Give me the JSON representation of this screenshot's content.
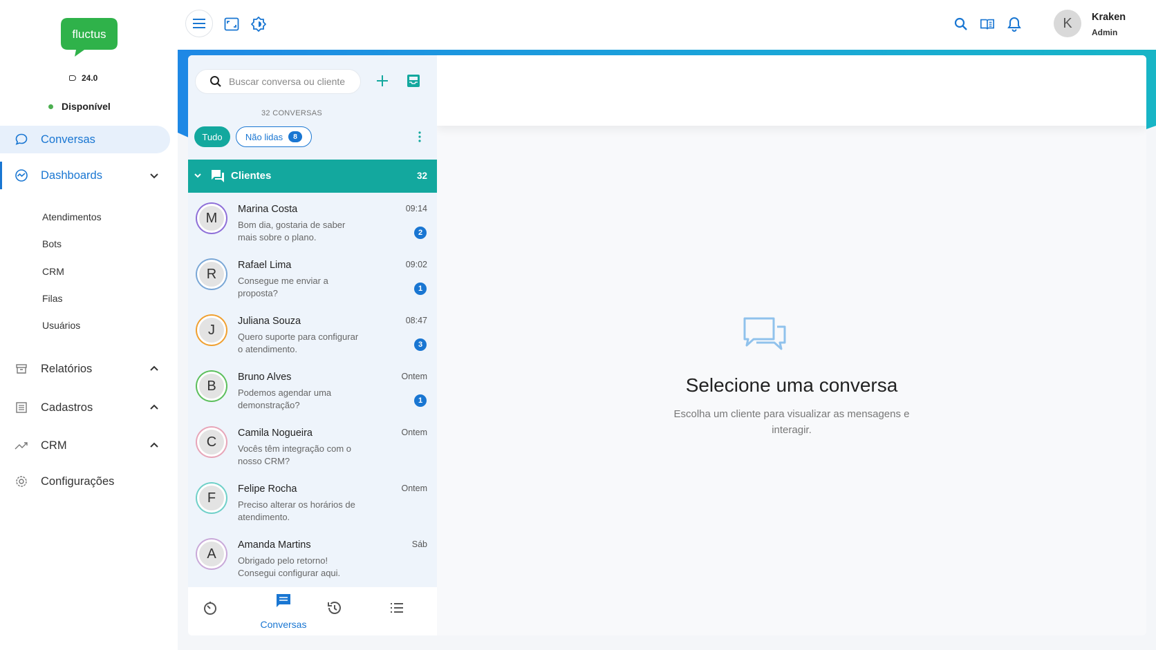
{
  "app": {
    "logo_text": "fluctus",
    "version": "24.0",
    "status": "Disponível"
  },
  "sidebar": {
    "items": [
      {
        "label": "Conversas",
        "icon": "chat-bubble-icon",
        "active": true
      },
      {
        "label": "Dashboards",
        "icon": "dashboard-icon",
        "expanded": true
      },
      {
        "label": "Relatórios",
        "icon": "archive-icon"
      },
      {
        "label": "Cadastros",
        "icon": "list-icon"
      },
      {
        "label": "CRM",
        "icon": "trending-icon"
      },
      {
        "label": "Configurações",
        "icon": "gear-icon"
      }
    ],
    "dashboards_sub": [
      "Atendimentos",
      "Bots",
      "CRM",
      "Filas",
      "Usuários"
    ]
  },
  "topbar": {
    "user_initial": "K",
    "user_name": "Kraken",
    "user_role": "Admin"
  },
  "conversations": {
    "search_placeholder": "Buscar conversa ou cliente",
    "count_label": "32 CONVERSAS",
    "filter_all": "Tudo",
    "filter_unread": "Não lidas",
    "unread_count": "8",
    "group_name": "Clientes",
    "group_count": "32",
    "items": [
      {
        "initial": "M",
        "name": "Marina Costa",
        "time": "09:14",
        "message": "Bom dia, gostaria de saber mais sobre o plano.",
        "unread": "2",
        "ring": "#8e6fd8"
      },
      {
        "initial": "R",
        "name": "Rafael Lima",
        "time": "09:02",
        "message": "Consegue me enviar a proposta?",
        "unread": "1",
        "ring": "#7aa7d6"
      },
      {
        "initial": "J",
        "name": "Juliana Souza",
        "time": "08:47",
        "message": "Quero suporte para configurar o atendimento.",
        "unread": "3",
        "ring": "#f0a030"
      },
      {
        "initial": "B",
        "name": "Bruno Alves",
        "time": "Ontem",
        "message": "Podemos agendar uma demonstração?",
        "unread": "1",
        "ring": "#5cbf5c"
      },
      {
        "initial": "C",
        "name": "Camila Nogueira",
        "time": "Ontem",
        "message": "Vocês têm integração com o nosso CRM?",
        "unread": "",
        "ring": "#e7a5b8"
      },
      {
        "initial": "F",
        "name": "Felipe Rocha",
        "time": "Ontem",
        "message": "Preciso alterar os horários de atendimento.",
        "unread": "",
        "ring": "#6fd0c8"
      },
      {
        "initial": "A",
        "name": "Amanda Martins",
        "time": "Sáb",
        "message": "Obrigado pelo retorno! Consegui configurar aqui.",
        "unread": "",
        "ring": "#c9a9d9"
      }
    ],
    "bottom_nav_active": "Conversas"
  },
  "main": {
    "empty_title": "Selecione uma conversa",
    "empty_subtitle": "Escolha um cliente para visualizar as mensagens e interagir."
  },
  "colors": {
    "primary": "#1976d2",
    "teal": "#13a89e",
    "logo_green": "#2fb24a"
  }
}
